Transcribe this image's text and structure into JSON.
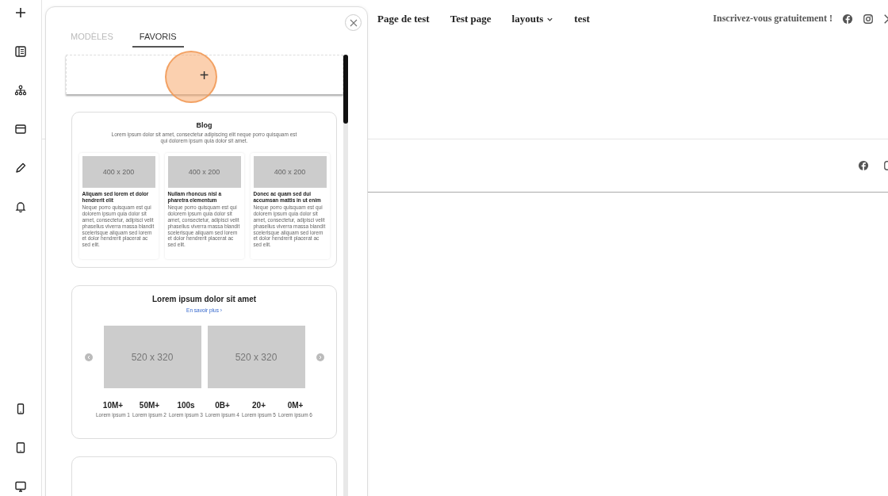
{
  "site_header": {
    "nav": [
      {
        "label": "Page de test",
        "dropdown": false
      },
      {
        "label": "Test page",
        "dropdown": false
      },
      {
        "label": "layouts",
        "dropdown": true
      },
      {
        "label": "test",
        "dropdown": false
      }
    ],
    "cta": "Inscrivez-vous gratuitement !"
  },
  "panel": {
    "tabs": [
      {
        "label": "MODÈLES",
        "selected": false
      },
      {
        "label": "FAVORIS",
        "selected": true
      }
    ],
    "add_button": {
      "label": "+"
    },
    "templates": [
      {
        "kind": "blog",
        "title": "Blog",
        "subtitle": "Lorem ipsum dolor sit amet, consectetur adipiscing elit neque porro quisquam est qui dolorem ipsum quia dolor sit amet.",
        "posts": [
          {
            "image_label": "400 x 200",
            "title": "Aliquam sed lorem et dolor hendrerit elit",
            "body": "Neque porro quisquam est qui dolorem ipsum quia dolor sit amet, consectetur, adipisci velit phasellus viverra massa blandit scelerisque aliquam sed lorem et dolor hendrerit placerat ac sed elit."
          },
          {
            "image_label": "400 x 200",
            "title": "Nullam rhoncus nisl a pharetra elementum",
            "body": "Neque porro quisquam est qui dolorem ipsum quia dolor sit amet, consectetur, adipisci velit phasellus viverra massa blandit scelerisque aliquam sed lorem et dolor hendrerit placerat ac sed elit."
          },
          {
            "image_label": "400 x 200",
            "title": "Donec ac quam sed dui accumsan mattis in ut enim",
            "body": "Neque porro quisquam est qui dolorem ipsum quia dolor sit amet, consectetur, adipisci velit phasellus viverra massa blandit scelerisque aliquam sed lorem et dolor hendrerit placerat ac sed elit."
          }
        ]
      },
      {
        "kind": "carousel",
        "title": "Lorem ipsum dolor sit amet",
        "link": "En savoir plus ›",
        "slides": [
          "520 x 320",
          "520 x 320"
        ],
        "stats": [
          {
            "value": "10M+",
            "label": "Lorem ipsum 1"
          },
          {
            "value": "50M+",
            "label": "Lorem ipsum 2"
          },
          {
            "value": "100s",
            "label": "Lorem ipsum 3"
          },
          {
            "value": "0B+",
            "label": "Lorem ipsum 4"
          },
          {
            "value": "20+",
            "label": "Lorem ipsum 5"
          },
          {
            "value": "0M+",
            "label": "Lorem ipsum 6"
          }
        ]
      },
      {
        "kind": "blank"
      }
    ]
  }
}
